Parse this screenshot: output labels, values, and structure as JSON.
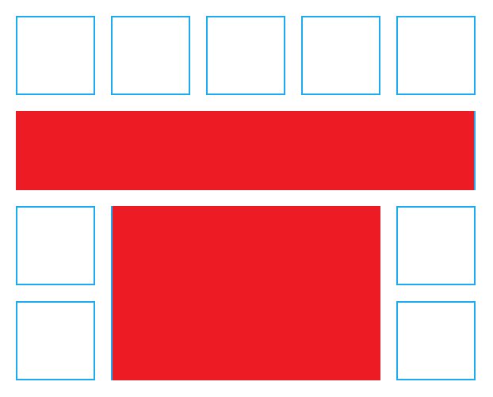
{
  "colors": {
    "cell_border": "#1aabf0",
    "cell_fill": "#ffffff",
    "block_fill": "#ed1c24",
    "background": "#ffffff"
  },
  "grid": {
    "columns": 5,
    "rows": 4,
    "empty_cells": [
      {
        "row": 1,
        "col": 1
      },
      {
        "row": 1,
        "col": 2
      },
      {
        "row": 1,
        "col": 3
      },
      {
        "row": 1,
        "col": 4
      },
      {
        "row": 1,
        "col": 5
      },
      {
        "row": 3,
        "col": 1
      },
      {
        "row": 3,
        "col": 5
      },
      {
        "row": 4,
        "col": 1
      },
      {
        "row": 4,
        "col": 5
      }
    ],
    "filled_blocks": [
      {
        "row_start": 2,
        "row_end": 2,
        "col_start": 1,
        "col_end": 5
      },
      {
        "row_start": 3,
        "row_end": 4,
        "col_start": 2,
        "col_end": 4
      }
    ]
  }
}
